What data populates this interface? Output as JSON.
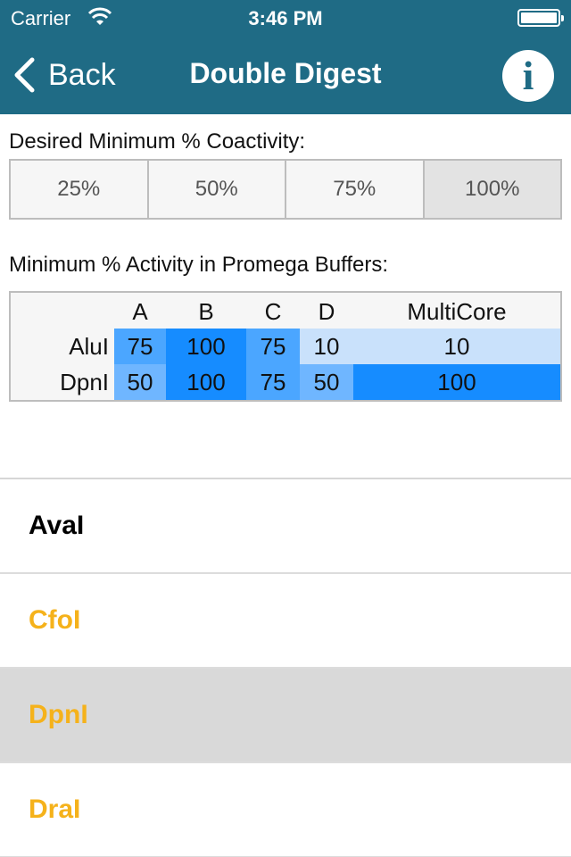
{
  "status_bar": {
    "carrier": "Carrier",
    "time": "3:46 PM"
  },
  "nav": {
    "back_label": "Back",
    "title": "Double Digest",
    "info_label": "i"
  },
  "coactivity": {
    "label": "Desired Minimum % Coactivity:",
    "options": [
      "25%",
      "50%",
      "75%",
      "100%"
    ],
    "selected": "100%"
  },
  "activity": {
    "label": "Minimum % Activity in Promega Buffers:",
    "columns": [
      "A",
      "B",
      "C",
      "D",
      "MultiCore"
    ],
    "rows": [
      {
        "name": "AluI",
        "values": [
          "75",
          "100",
          "75",
          "10",
          "10"
        ]
      },
      {
        "name": "DpnI",
        "values": [
          "50",
          "100",
          "75",
          "50",
          "100"
        ]
      }
    ]
  },
  "enzymes": [
    {
      "name": "AvaI",
      "color": "#000000",
      "selected": false
    },
    {
      "name": "CfoI",
      "color": "#f5b21b",
      "selected": false
    },
    {
      "name": "DpnI",
      "color": "#f5b21b",
      "selected": true
    },
    {
      "name": "DraI",
      "color": "#f5b21b",
      "selected": false
    }
  ],
  "colors": {
    "nav_bg": "#1f6b85",
    "activity_100": "#168cff",
    "activity_75": "#4ba6ff",
    "activity_50": "#6fb6ff",
    "activity_10": "#c9e1fb",
    "accent_yellow": "#f5b21b"
  }
}
